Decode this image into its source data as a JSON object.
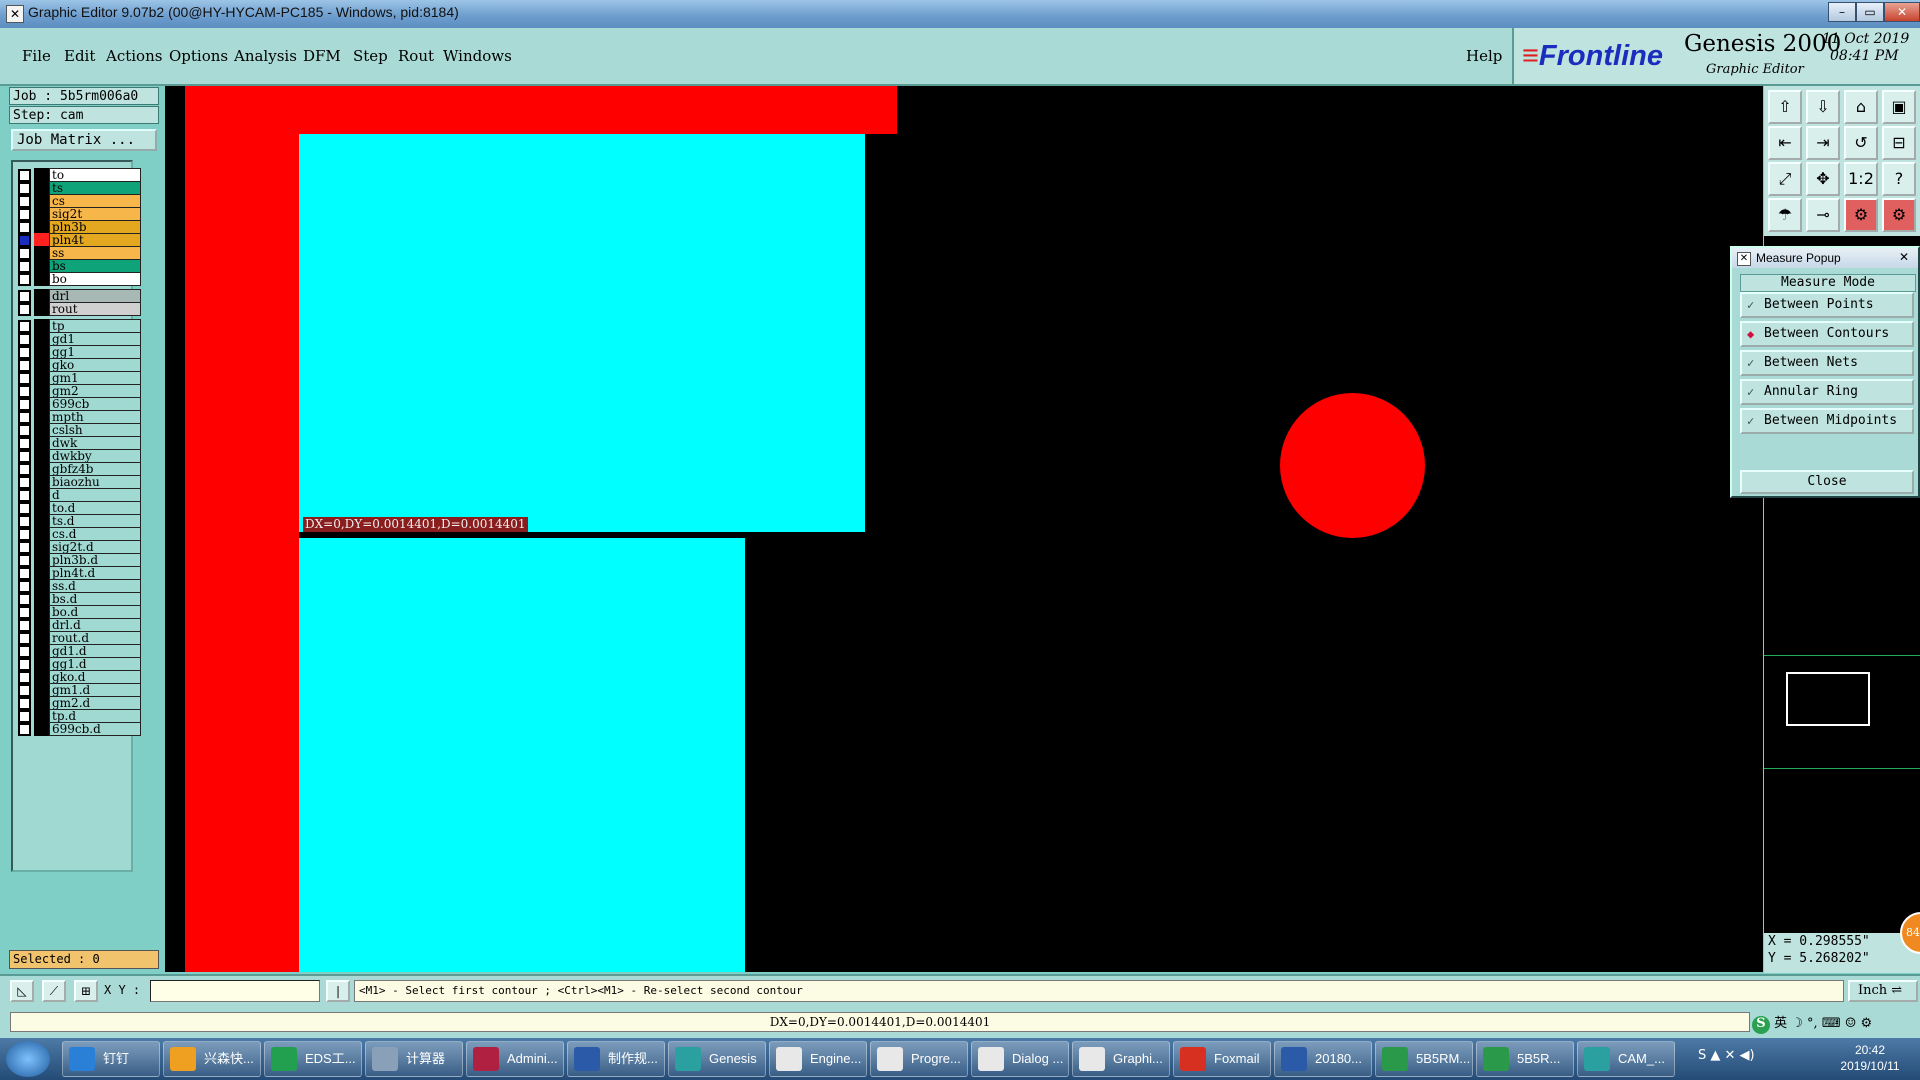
{
  "window": {
    "title": "Graphic Editor 9.07b2 (00@HY-HYCAM-PC185 - Windows, pid:8184)"
  },
  "menu": {
    "items": [
      "File",
      "Edit",
      "Actions",
      "Options",
      "Analysis",
      "DFM",
      "Step",
      "Rout",
      "Windows"
    ],
    "help": "Help"
  },
  "brand": {
    "logo": "Frontline",
    "product": "Genesis 2000",
    "subtitle": "Graphic Editor",
    "date": "11 Oct 2019",
    "time": "08:41 PM"
  },
  "job": {
    "job": "Job : 5b5rm006a0",
    "step": "Step: cam",
    "matrix_button": "Job Matrix ..."
  },
  "layers": [
    {
      "name": "to",
      "color": "#ffffff",
      "mark": "↙"
    },
    {
      "name": "ts",
      "color": "#0fa37a"
    },
    {
      "name": "cs",
      "color": "#f6b64a"
    },
    {
      "name": "sig2t",
      "color": "#f6b64a"
    },
    {
      "name": "pln3b",
      "color": "#e3a820"
    },
    {
      "name": "pln4t",
      "color": "#e3a820",
      "mark": "▪",
      "active": true
    },
    {
      "name": "ss",
      "color": "#f6b64a"
    },
    {
      "name": "bs",
      "color": "#0fa37a"
    },
    {
      "name": "bo",
      "color": "#ffffff"
    },
    {
      "name": "drl",
      "color": "#a8b8b4",
      "gap": true
    },
    {
      "name": "rout",
      "color": "#d0d0d0"
    },
    {
      "name": "tp",
      "color": "#a0d8d2",
      "gap": true
    },
    {
      "name": "gd1",
      "color": "#a0d8d2",
      "mark": "↙"
    },
    {
      "name": "gg1",
      "color": "#a0d8d2"
    },
    {
      "name": "gko",
      "color": "#a0d8d2"
    },
    {
      "name": "gm1",
      "color": "#a0d8d2"
    },
    {
      "name": "gm2",
      "color": "#a0d8d2"
    },
    {
      "name": "699cb",
      "color": "#a0d8d2"
    },
    {
      "name": "mpth",
      "color": "#a0d8d2"
    },
    {
      "name": "cslsh",
      "color": "#a0d8d2"
    },
    {
      "name": "dwk",
      "color": "#a0d8d2"
    },
    {
      "name": "dwkby",
      "color": "#a0d8d2"
    },
    {
      "name": "gbfz4b",
      "color": "#a0d8d2"
    },
    {
      "name": "biaozhu",
      "color": "#a0d8d2"
    },
    {
      "name": "d",
      "color": "#a0d8d2"
    },
    {
      "name": "to.d",
      "color": "#a0d8d2",
      "mark": "↙"
    },
    {
      "name": "ts.d",
      "color": "#a0d8d2"
    },
    {
      "name": "cs.d",
      "color": "#a0d8d2"
    },
    {
      "name": "sig2t.d",
      "color": "#a0d8d2"
    },
    {
      "name": "pln3b.d",
      "color": "#a0d8d2"
    },
    {
      "name": "pln4t.d",
      "color": "#a0d8d2"
    },
    {
      "name": "ss.d",
      "color": "#a0d8d2"
    },
    {
      "name": "bs.d",
      "color": "#a0d8d2"
    },
    {
      "name": "bo.d",
      "color": "#a0d8d2"
    },
    {
      "name": "drl.d",
      "color": "#a0d8d2"
    },
    {
      "name": "rout.d",
      "color": "#a0d8d2"
    },
    {
      "name": "gd1.d",
      "color": "#a0d8d2",
      "mark": "↙"
    },
    {
      "name": "gg1.d",
      "color": "#a0d8d2"
    },
    {
      "name": "gko.d",
      "color": "#a0d8d2"
    },
    {
      "name": "gm1.d",
      "color": "#a0d8d2"
    },
    {
      "name": "gm2.d",
      "color": "#a0d8d2"
    },
    {
      "name": "tp.d",
      "color": "#a0d8d2"
    },
    {
      "name": "699cb.d",
      "color": "#a0d8d2"
    }
  ],
  "selected": "Selected : 0",
  "canvas": {
    "measure_label": "DX=0,DY=0.0014401,D=0.0014401"
  },
  "toolbar_icons": [
    "⇧",
    "⇩",
    "⌂",
    "▣",
    "⇤",
    "⇥",
    "↺",
    "⊟",
    "⤢",
    "✥",
    "1:2",
    "?",
    "☂",
    "⊸",
    "⚙",
    "⚙"
  ],
  "popup": {
    "title": "Measure Popup",
    "mode_title": "Measure Mode",
    "options": [
      {
        "label": "Between Points",
        "selected": false
      },
      {
        "label": "Between Contours",
        "selected": true
      },
      {
        "label": "Between Nets",
        "selected": false
      },
      {
        "label": "Annular Ring",
        "selected": false
      },
      {
        "label": "Between Midpoints",
        "selected": false
      }
    ],
    "close": "Close"
  },
  "coords": {
    "x": "X = 0.298555\"",
    "y": "Y = 5.268202\""
  },
  "cmd": {
    "xy_label": "X Y :",
    "xy_value": "",
    "prompt": "<M1> - Select first contour ; <Ctrl><M1> - Re-select second contour",
    "unit": "Inch ⇌"
  },
  "status": {
    "message": "DX=0,DY=0.0014401,D=0.0014401",
    "ime": "英 ☽ °, ⌨ ☺ ⚙"
  },
  "taskbar": {
    "items": [
      {
        "label": "钉钉",
        "icon_color": "#2a7fd6"
      },
      {
        "label": "兴森快...",
        "icon_color": "#f0a020"
      },
      {
        "label": "EDS工...",
        "icon_color": "#22a050"
      },
      {
        "label": "计算器",
        "icon_color": "#8aa0b8"
      },
      {
        "label": "Admini...",
        "icon_color": "#b02040"
      },
      {
        "label": "制作规...",
        "icon_color": "#2a5aa8"
      },
      {
        "label": "Genesis",
        "icon_color": "#2aa0a0"
      },
      {
        "label": "Engine...",
        "icon_color": "#e8e8e8"
      },
      {
        "label": "Progre...",
        "icon_color": "#e8e8e8"
      },
      {
        "label": "Dialog ...",
        "icon_color": "#e8e8e8"
      },
      {
        "label": "Graphi...",
        "icon_color": "#e8e8e8"
      },
      {
        "label": "Foxmail",
        "icon_color": "#d83020"
      },
      {
        "label": "20180...",
        "icon_color": "#2a5aa8"
      },
      {
        "label": "5B5RM...",
        "icon_color": "#2a9a4a"
      },
      {
        "label": "5B5R...",
        "icon_color": "#2a9a4a"
      },
      {
        "label": "CAM_...",
        "icon_color": "#2aa0a0"
      }
    ],
    "time": "20:42",
    "date": "2019/10/11"
  }
}
